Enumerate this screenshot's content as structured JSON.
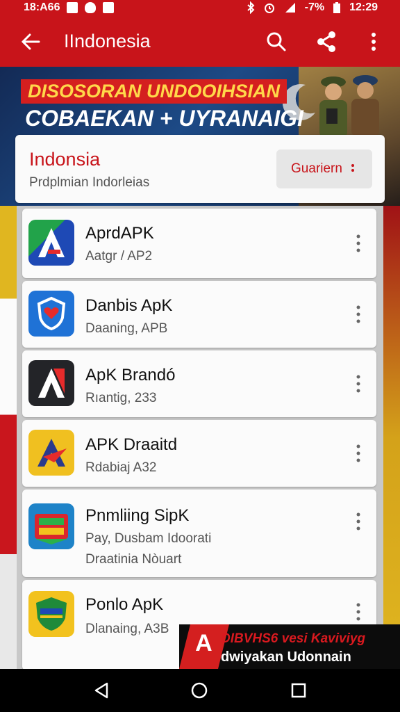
{
  "status_bar": {
    "time_left": "18:A66",
    "battery": "-7%",
    "time_right": "12:29"
  },
  "app_bar": {
    "title": "IIndonesia",
    "icons": [
      "back-arrow-icon",
      "search-icon",
      "share-icon",
      "more-vert-icon"
    ]
  },
  "banner": {
    "line1": "DISOSORAN UNDOOIHSIAN",
    "line2": "COBAEKAN + UYRANAIGI"
  },
  "header_card": {
    "title": "Indonsia",
    "subtitle": "Prdplmian Indorleias",
    "button_label": "Guariern"
  },
  "apps": [
    {
      "name": "AprdAPK",
      "meta": "Aatgr / AP2",
      "meta2": "",
      "icon": "a-logo-icon",
      "icon_color": "#1e49b5"
    },
    {
      "name": "Danbis ApK",
      "meta": "Daaning, APB",
      "meta2": "",
      "icon": "shield-heart-icon",
      "icon_color": "#1f72d6"
    },
    {
      "name": "ApK Brandó",
      "meta": "Rıantig, 233",
      "meta2": "",
      "icon": "a-logo-dark-icon",
      "icon_color": "#232428"
    },
    {
      "name": "APK Draaitd",
      "meta": "Rdabiaj A32",
      "meta2": "",
      "icon": "a-star-icon",
      "icon_color": "#f0c020"
    },
    {
      "name": "Pnmliing SipK",
      "meta": "Pay, Dusbam Idoorati",
      "meta2": "Draatinia Nòuart",
      "icon": "colorful-badge-icon",
      "icon_color": "#1e83c8"
    },
    {
      "name": "Ponlo ApK",
      "meta": "Dlanaing, A3B",
      "meta2": "",
      "icon": "green-shield-icon",
      "icon_color": "#1f8a3a"
    }
  ],
  "ad": {
    "logo_letter": "A",
    "line1": "DIBVHS6 vesi Kaviviyg",
    "line2": "dwiyakan Udonnain"
  },
  "nav_bar": {
    "icons": [
      "back-triangle-icon",
      "home-circle-icon",
      "recents-square-icon"
    ]
  }
}
